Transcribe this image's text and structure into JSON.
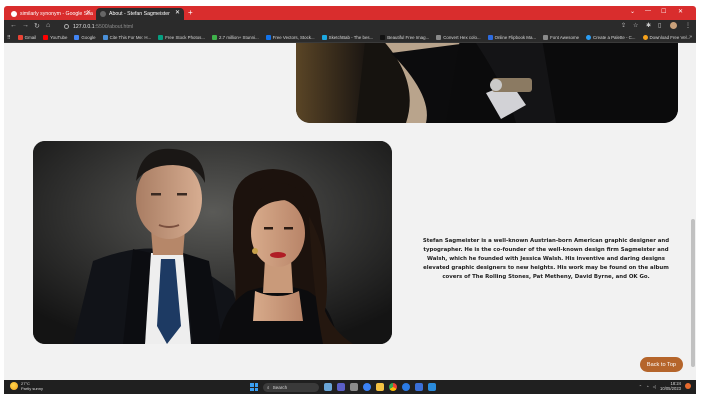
{
  "browser": {
    "tabs": [
      {
        "title": "similarly synonym - Google Sea",
        "active": false
      },
      {
        "title": "About - Stefan Sagmeister",
        "active": true
      }
    ],
    "url_host": "127.0.0.1",
    "url_path": ":5500/about.html",
    "bookmarks": [
      {
        "label": "Gmail",
        "color": "#ea4335"
      },
      {
        "label": "YouTube",
        "color": "#ff0000"
      },
      {
        "label": "Google",
        "color": "#4285f4"
      },
      {
        "label": "Cite This For Me: H...",
        "color": "#4a90d9"
      },
      {
        "label": "Free Stock Photos...",
        "color": "#05a081"
      },
      {
        "label": "2.7 million+ Stunni...",
        "color": "#3fb24b"
      },
      {
        "label": "Free Vectors, Stock...",
        "color": "#1273eb"
      },
      {
        "label": "SketchBab - The bes...",
        "color": "#1ca8e0"
      },
      {
        "label": "Beautiful Free Imag...",
        "color": "#111111"
      },
      {
        "label": "Convert Hex colo...",
        "color": "#8a8a8a"
      },
      {
        "label": "Online Flipbook Ma...",
        "color": "#2d6be0"
      },
      {
        "label": "Font Awesome",
        "color": "#8a8a8a"
      },
      {
        "label": "Create a Palette - C...",
        "color": "#2a9df4"
      },
      {
        "label": "Download Free Vel...",
        "color": "#f7a21b"
      }
    ]
  },
  "page": {
    "bio": "Stefan Sagmeister is a well-known Austrian-born American graphic designer and typographer. He is the co-founder of the well-known design firm Sagmeister and Walsh, which he founded with Jessica Walsh. His inventive and daring designs elevated graphic designers to new heights. His work may be found on the album covers of The Rolling Stones, Pat Metheny, David Byrne, and OK Go.",
    "back_to_top": "Back to Top"
  },
  "taskbar": {
    "temperature": "27°C",
    "weather": "Partly sunny",
    "search": "Search",
    "time": "18:24",
    "date": "10/05/2023"
  },
  "colors": {
    "tab_strip": "#d92d2d",
    "accent_button": "#b5652b",
    "page_bg": "#f2f2f2"
  }
}
